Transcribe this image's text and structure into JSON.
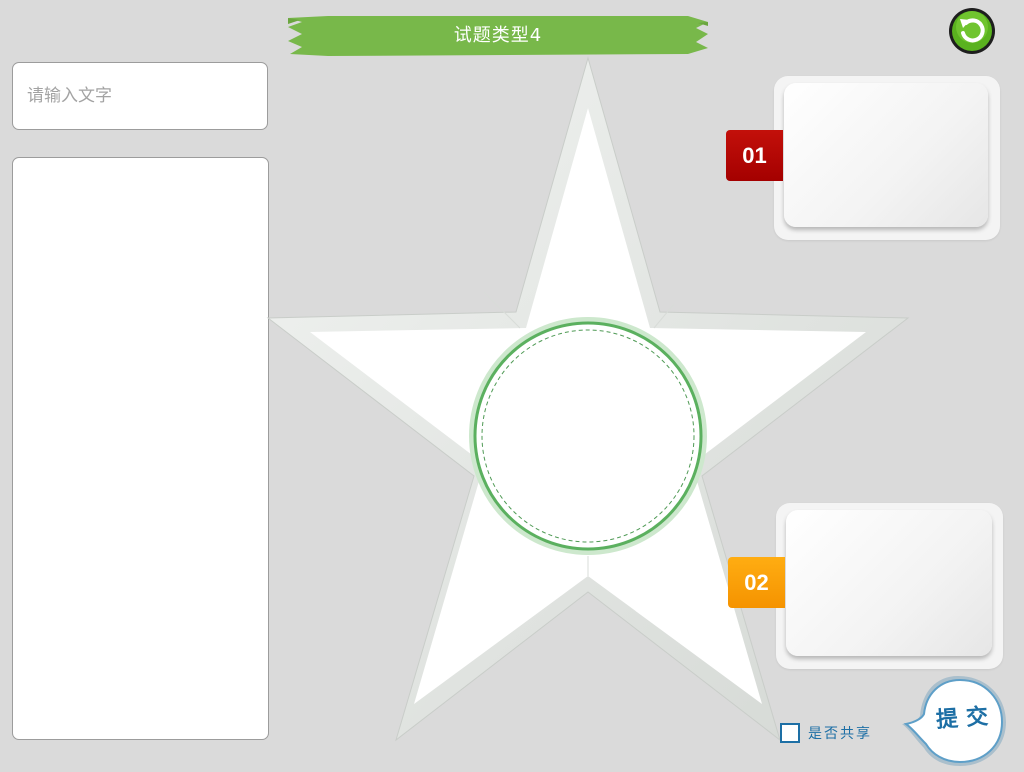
{
  "header": {
    "title": "试题类型4"
  },
  "input": {
    "placeholder": "请输入文字"
  },
  "cards": [
    {
      "number": "01"
    },
    {
      "number": "02"
    }
  ],
  "share": {
    "label": "是否共享",
    "checked": false
  },
  "submit": {
    "label": "提交"
  },
  "colors": {
    "ribbon_green": "#78b84a",
    "tag_01": "#b80707",
    "tag_02": "#fba10a",
    "refresh_green": "#5ab21f",
    "circle_green": "#5bb05f",
    "submit_blue": "#1d6fa5"
  },
  "icons": {
    "refresh": "refresh-icon",
    "submit_bubble": "speech-bubble-icon"
  }
}
